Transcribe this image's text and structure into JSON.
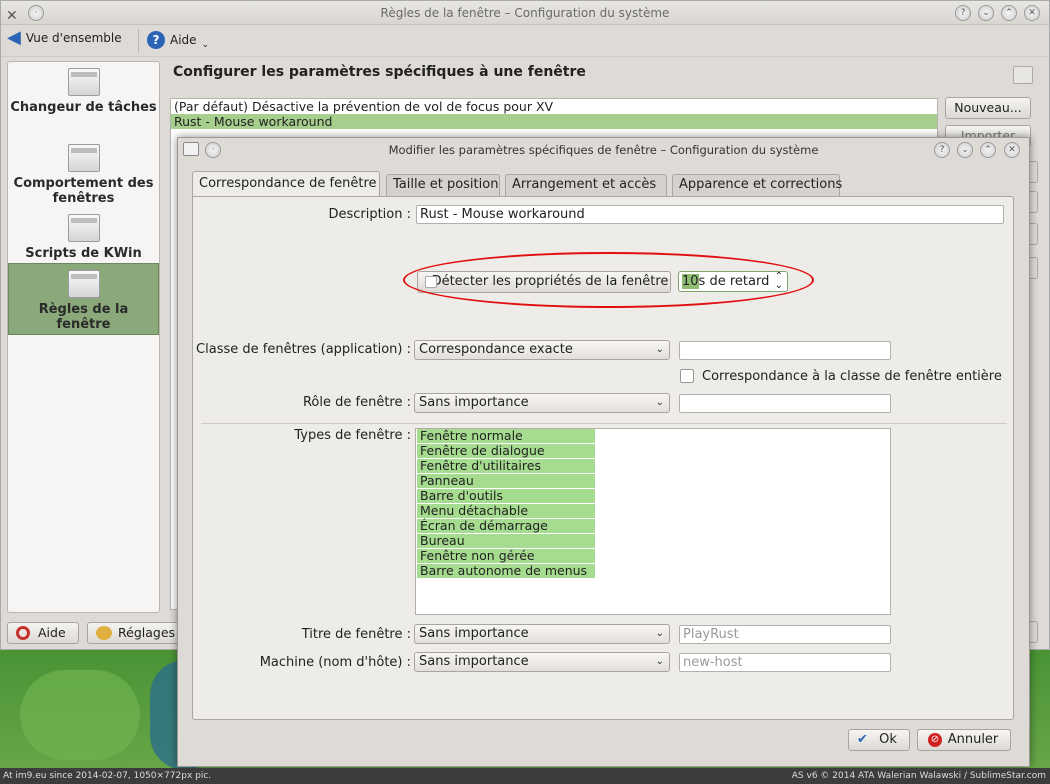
{
  "main_window": {
    "title": "Règles de la fenêtre – Configuration du système",
    "toolbar": {
      "back_label": "Vue d'ensemble",
      "help_label": "Aide"
    },
    "sidebar": [
      {
        "label": "Changeur de tâches"
      },
      {
        "label": "Comportement des fenêtres"
      },
      {
        "label": "Scripts de KWin"
      },
      {
        "label": "Règles de la fenêtre",
        "selected": true
      }
    ],
    "heading": "Configurer les paramètres spécifiques à une fenêtre",
    "rules": [
      "(Par défaut) Désactive la prévention de vol de focus pour XV",
      "Rust - Mouse workaround"
    ],
    "buttons": {
      "new": "Nouveau...",
      "import": "Importer"
    },
    "bottom": {
      "help": "Aide",
      "settings": "Réglages"
    }
  },
  "dialog": {
    "title": "Modifier les paramètres spécifiques de fenêtre – Configuration du système",
    "tabs": [
      "Correspondance de fenêtre",
      "Taille et position",
      "Arrangement et accès",
      "Apparence et corrections"
    ],
    "description": {
      "label": "Description :",
      "value": "Rust - Mouse workaround"
    },
    "detect": {
      "button": "Détecter les propriétés de la fenêtre",
      "delay_value": "10",
      "delay_suffix": "s de retard"
    },
    "window_class": {
      "label": "Classe de fenêtres (application) :",
      "match": "Correspondance exacte",
      "value": ""
    },
    "whole_class": {
      "label": "Correspondance à la classe de fenêtre entière",
      "checked": false
    },
    "role": {
      "label": "Rôle de fenêtre :",
      "match": "Sans importance",
      "value": ""
    },
    "types": {
      "label": "Types de fenêtre :",
      "items": [
        "Fenêtre normale",
        "Fenêtre de dialogue",
        "Fenêtre d'utilitaires",
        "Panneau",
        "Barre d'outils",
        "Menu détachable",
        "Écran de démarrage",
        "Bureau",
        "Fenêtre non gérée",
        "Barre autonome de menus"
      ]
    },
    "title_field": {
      "label": "Titre de fenêtre :",
      "match": "Sans importance",
      "placeholder": "PlayRust"
    },
    "machine": {
      "label": "Machine (nom d'hôte) :",
      "match": "Sans importance",
      "placeholder": "new-host"
    },
    "ok": "Ok",
    "cancel": "Annuler"
  },
  "footer": {
    "left": "At im9.eu  since 2014-02-07, 1050×772px pic.",
    "right": "AS v6 © 2014 ATA Walerian Walawski / SublimeStar.com"
  },
  "colors": {
    "selection": "#a6cf8e",
    "highlight_oval": "#e01010"
  }
}
